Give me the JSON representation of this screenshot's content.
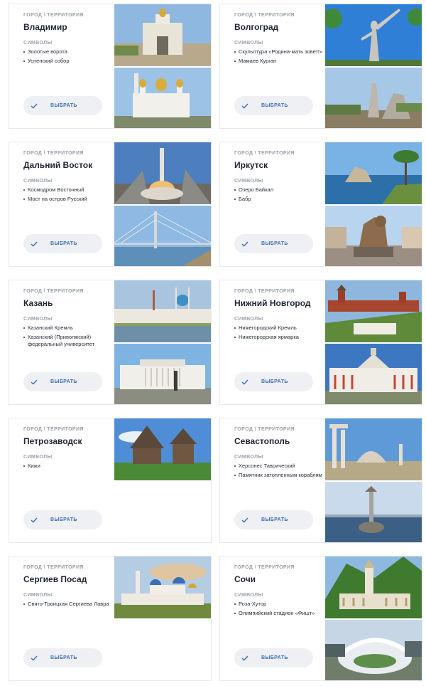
{
  "category_label": "ГОРОД \\ ТЕРРИТОРИЯ",
  "symbols_label": "СИМВОЛЫ",
  "select_label": "ВЫБРАТЬ",
  "cards": [
    {
      "city": "Владимир",
      "symbols": [
        "Золотые ворота",
        "Успенский собор"
      ]
    },
    {
      "city": "Волгоград",
      "symbols": [
        "Скульптура «Родина-мать зовет!»",
        "Мамаев Курган"
      ]
    },
    {
      "city": "Дальний Восток",
      "symbols": [
        "Космодром Восточный",
        "Мост на остров Русский"
      ]
    },
    {
      "city": "Иркутск",
      "symbols": [
        "Озеро Байкал",
        "Бабр"
      ]
    },
    {
      "city": "Казань",
      "symbols": [
        "Казанский Кремль",
        "Казанский (Приволжский) федеральный университет"
      ]
    },
    {
      "city": "Нижний Новгород",
      "symbols": [
        "Нижегородский Кремль",
        "Нижегородская ярмарка"
      ]
    },
    {
      "city": "Петрозаводск",
      "symbols": [
        "Кижи"
      ]
    },
    {
      "city": "Севастополь",
      "symbols": [
        "Херсонес Таврический",
        "Памятник затопленным кораблям"
      ]
    },
    {
      "city": "Сергиев Посад",
      "symbols": [
        "Свято-Троицкая Сергиева Лавра"
      ]
    },
    {
      "city": "Сочи",
      "symbols": [
        "Роза-Хутор",
        "Олимпийский стадион «Фишт»"
      ]
    }
  ],
  "colors": {
    "accent": "#3d6fb8",
    "button_bg": "#eef0f4",
    "border": "#e7e9ee"
  }
}
